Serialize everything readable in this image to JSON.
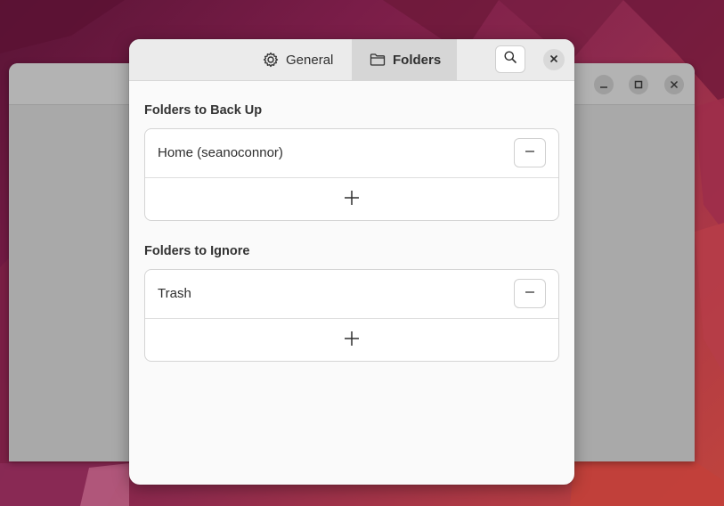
{
  "dialog": {
    "tabs": [
      {
        "label": "General",
        "icon": "gear-icon",
        "selected": false
      },
      {
        "label": "Folders",
        "icon": "folder-icon",
        "selected": true
      }
    ],
    "search_icon": "search-icon",
    "close_icon": "close-icon"
  },
  "backup": {
    "title": "Folders to Back Up",
    "items": [
      {
        "label": "Home (seanoconnor)",
        "remove_icon": "minus-icon"
      }
    ],
    "add_icon": "plus-icon"
  },
  "ignore": {
    "title": "Folders to Ignore",
    "items": [
      {
        "label": "Trash",
        "remove_icon": "minus-icon"
      }
    ],
    "add_icon": "plus-icon"
  },
  "parent_window": {
    "controls": [
      "minimize-icon",
      "maximize-icon",
      "close-icon"
    ]
  },
  "colors": {
    "wallpaper": "#8e2a4e",
    "dialog_bg": "#fafafa",
    "header_bg": "#ebebeb",
    "selected_tab_bg": "#d6d6d6"
  }
}
